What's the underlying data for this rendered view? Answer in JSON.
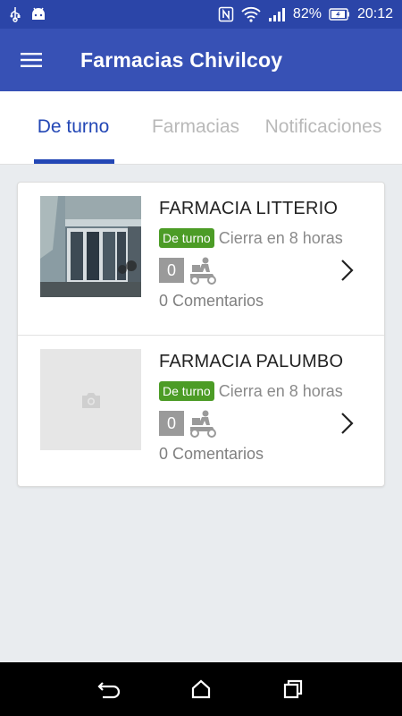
{
  "status_bar": {
    "battery": "82%",
    "time": "20:12",
    "icons": [
      "usb-icon",
      "android-icon",
      "nfc-icon",
      "wifi-icon",
      "signal-icon",
      "battery-icon"
    ]
  },
  "app_bar": {
    "title": "Farmacias Chivilcoy",
    "menu_icon": "hamburger-menu-icon"
  },
  "tabs": [
    {
      "label": "De turno",
      "active": true
    },
    {
      "label": "Farmacias",
      "active": false
    },
    {
      "label": "Notificaciones",
      "active": false
    }
  ],
  "pharmacies": [
    {
      "name": "FARMACIA LITTERIO",
      "badge": "De turno",
      "closes": "Cierra en 8 horas",
      "count": "0",
      "comments": "0 Comentarios",
      "has_photo": true
    },
    {
      "name": "FARMACIA PALUMBO",
      "badge": "De turno",
      "closes": "Cierra en 8 horas",
      "count": "0",
      "comments": "0 Comentarios",
      "has_photo": false
    }
  ],
  "colors": {
    "status_bar": "#2b45a8",
    "app_bar": "#3751b5",
    "accent": "#2347b5",
    "badge": "#4c9c26"
  }
}
